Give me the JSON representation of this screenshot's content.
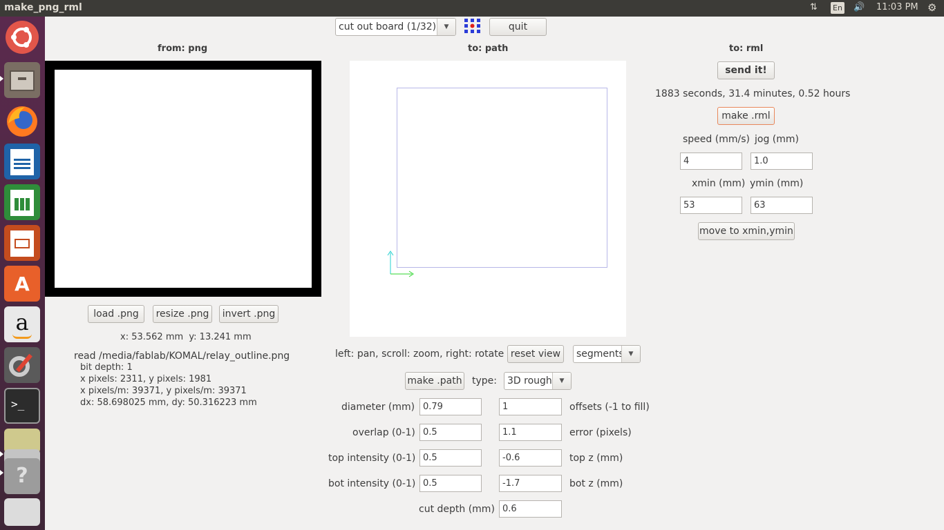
{
  "window": {
    "title": "make_png_rml"
  },
  "tray": {
    "keyboard": "En",
    "clock": "11:03 PM"
  },
  "toolbar": {
    "process_select": "cut out board (1/32)",
    "quit_label": "quit"
  },
  "columns": {
    "from": "from: png",
    "to_path": "to: path",
    "to_rml": "to: rml"
  },
  "png": {
    "load_label": "load .png",
    "resize_label": "resize .png",
    "invert_label": "invert .png",
    "coords": "x: 53.562 mm  y: 13.241 mm",
    "info": [
      "read /media/fablab/KOMAL/relay_outline.png",
      "bit depth: 1",
      "x pixels: 2311, y pixels: 1981",
      "x pixels/m: 39371, y pixels/m: 39371",
      "dx: 58.698025 mm, dy: 50.316223 mm"
    ]
  },
  "path": {
    "help": "left: pan, scroll: zoom, right: rotate",
    "reset_view_label": "reset view",
    "view_mode": "segments",
    "make_path_label": "make .path",
    "type_label": "type:",
    "type_value": "3D rough",
    "params_left": [
      {
        "label": "diameter (mm)",
        "value": "0.79"
      },
      {
        "label": "overlap (0-1)",
        "value": "0.5"
      },
      {
        "label": "top intensity (0-1)",
        "value": "0.5"
      },
      {
        "label": "bot intensity (0-1)",
        "value": "0.5"
      },
      {
        "label": "cut depth (mm)",
        "value": "0.6"
      }
    ],
    "params_right": [
      {
        "label": "offsets (-1 to fill)",
        "value": "1"
      },
      {
        "label": "error (pixels)",
        "value": "1.1"
      },
      {
        "label": "top z (mm)",
        "value": "-0.6"
      },
      {
        "label": "bot z (mm)",
        "value": "-1.7"
      }
    ]
  },
  "rml": {
    "send_label": "send it!",
    "time_estimate": "1883 seconds, 31.4 minutes, 0.52 hours",
    "make_rml_label": "make .rml",
    "speed_label": "speed (mm/s)",
    "speed_value": "4",
    "jog_label": "jog (mm)",
    "jog_value": "1.0",
    "xmin_label": "xmin (mm)",
    "xmin_value": "53",
    "ymin_label": "ymin (mm)",
    "ymin_value": "63",
    "move_label": "move to xmin,ymin"
  },
  "colors": {
    "launcher_bg": "#5b2a4e",
    "panel_bg": "#3c3b37",
    "focus_border": "#e9875a",
    "path_outline": "#b7b7e8"
  }
}
